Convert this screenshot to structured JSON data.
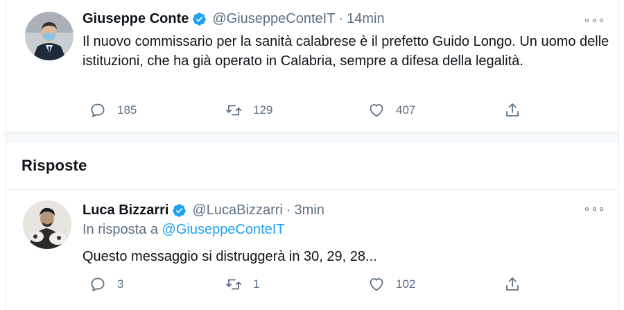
{
  "colors": {
    "accent": "#1da1f2",
    "text": "#0f1419",
    "muted": "#5b7083",
    "border": "#e6ecf0"
  },
  "tweet": {
    "author_name": "Giuseppe Conte",
    "handle": "@GiuseppeConteIT",
    "separator": "·",
    "time": "14min",
    "text": "Il nuovo commissario per la sanità calabrese è il prefetto Guido Longo. Un uomo delle istituzioni, che ha già operato in Calabria, sempre a difesa della legalità.",
    "replies": "185",
    "retweets": "129",
    "likes": "407",
    "icons": [
      "reply-icon",
      "retweet-icon",
      "like-icon",
      "share-icon",
      "verified-badge-icon",
      "more-options-icon"
    ]
  },
  "section": {
    "title": "Risposte"
  },
  "reply": {
    "author_name": "Luca Bizzarri",
    "handle": "@LucaBizzarri",
    "separator": "·",
    "time": "3min",
    "reply_prefix": "In risposta a",
    "reply_mention": "@GiuseppeConteIT",
    "text": "Questo messaggio si distruggerà in 30, 29, 28...",
    "replies": "3",
    "retweets": "1",
    "likes": "102"
  }
}
